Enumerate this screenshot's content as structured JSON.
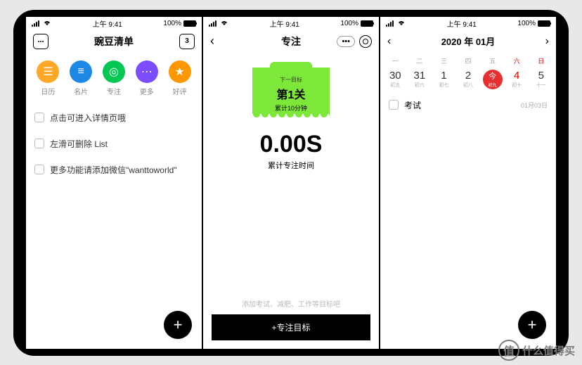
{
  "status": {
    "time": "上午 9:41",
    "battery": "100%"
  },
  "panel1": {
    "title": "豌豆清单",
    "icons": [
      {
        "label": "日历",
        "color": "#ffa726",
        "glyph": "☰"
      },
      {
        "label": "名片",
        "color": "#1e88e5",
        "glyph": "≡"
      },
      {
        "label": "专注",
        "color": "#00c853",
        "glyph": "◎"
      },
      {
        "label": "更多",
        "color": "#7c4dff",
        "glyph": "⋯"
      },
      {
        "label": "好评",
        "color": "#ff9800",
        "glyph": "★"
      }
    ],
    "items": [
      "点击可进入详情页哦",
      "左滑可删除 List",
      "更多功能请添加微信\"wanttoworld\""
    ],
    "cal_badge": "3"
  },
  "panel2": {
    "title": "专注",
    "next_label": "下一目标",
    "level": "第1关",
    "cumulative": "累计10分钟",
    "timer_value": "0.00S",
    "timer_label": "累计专注时间",
    "hint": "添加考试、减肥、工作等目标吧",
    "button": "+专注目标"
  },
  "panel3": {
    "title": "2020 年 01月",
    "weekdays": [
      "一",
      "二",
      "三",
      "四",
      "五",
      "六",
      "日"
    ],
    "dates": [
      {
        "num": "30",
        "lunar": "初五"
      },
      {
        "num": "31",
        "lunar": "初六"
      },
      {
        "num": "1",
        "lunar": "初七"
      },
      {
        "num": "2",
        "lunar": "初八"
      },
      {
        "num": "今",
        "lunar": "初九",
        "today": true
      },
      {
        "num": "4",
        "lunar": "初十"
      },
      {
        "num": "5",
        "lunar": "十一"
      }
    ],
    "event": {
      "name": "考试",
      "date": "01月03日"
    }
  },
  "watermark": "什么值得买"
}
